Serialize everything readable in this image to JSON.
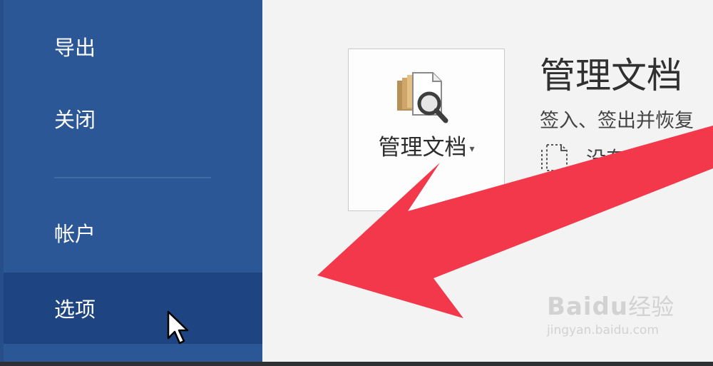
{
  "sidebar": {
    "items": [
      {
        "label": "导出"
      },
      {
        "label": "关闭"
      },
      {
        "label": "帐户"
      },
      {
        "label": "选项",
        "selected": true
      }
    ]
  },
  "manage_documents": {
    "button_label": "管理文档",
    "title": "管理文档",
    "description": "签入、签出并恢复",
    "version_text": "没有任何"
  },
  "watermark": {
    "brand": "Baidu",
    "cn": "经验",
    "url": "jingyan.baidu.com"
  },
  "colors": {
    "sidebar": "#2b5797",
    "sidebar_selected": "#1e4582",
    "arrow": "#f2384a"
  },
  "icons": [
    "manage-document-icon",
    "caret-down-icon",
    "document-version-icon",
    "arrow-pointer-icon"
  ]
}
